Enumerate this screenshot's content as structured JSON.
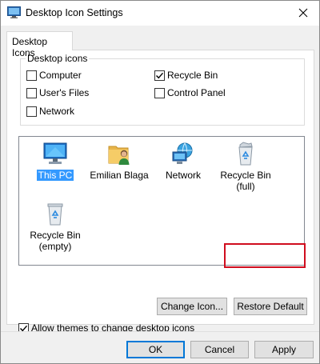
{
  "window": {
    "title": "Desktop Icon Settings"
  },
  "tabs": [
    {
      "label": "Desktop Icons"
    }
  ],
  "desktop_icons_group": {
    "label": "Desktop icons",
    "checkboxes": [
      {
        "label": "Computer",
        "checked": false
      },
      {
        "label": "Recycle Bin",
        "checked": true
      },
      {
        "label": "User's Files",
        "checked": false
      },
      {
        "label": "Control Panel",
        "checked": false
      },
      {
        "label": "Network",
        "checked": false
      }
    ]
  },
  "icon_list": [
    {
      "label": "This PC",
      "icon": "this-pc-icon",
      "selected": true
    },
    {
      "label": "Emilian Blaga",
      "icon": "user-folder-icon",
      "selected": false
    },
    {
      "label": "Network",
      "icon": "network-icon",
      "selected": false
    },
    {
      "label": "Recycle Bin\n(full)",
      "line1": "Recycle Bin",
      "line2": "(full)",
      "icon": "recycle-bin-full-icon",
      "selected": false
    },
    {
      "label": "Recycle Bin\n(empty)",
      "line1": "Recycle Bin",
      "line2": "(empty)",
      "icon": "recycle-bin-empty-icon",
      "selected": false
    }
  ],
  "buttons": {
    "change_icon": "Change Icon...",
    "restore_default": "Restore Default"
  },
  "allow_themes": {
    "label": "Allow themes to change desktop icons",
    "checked": true
  },
  "footer": {
    "ok": "OK",
    "cancel": "Cancel",
    "apply": "Apply"
  },
  "colors": {
    "highlight": "#d00d1e",
    "selection": "#3399ff",
    "accent": "#0078d7"
  }
}
